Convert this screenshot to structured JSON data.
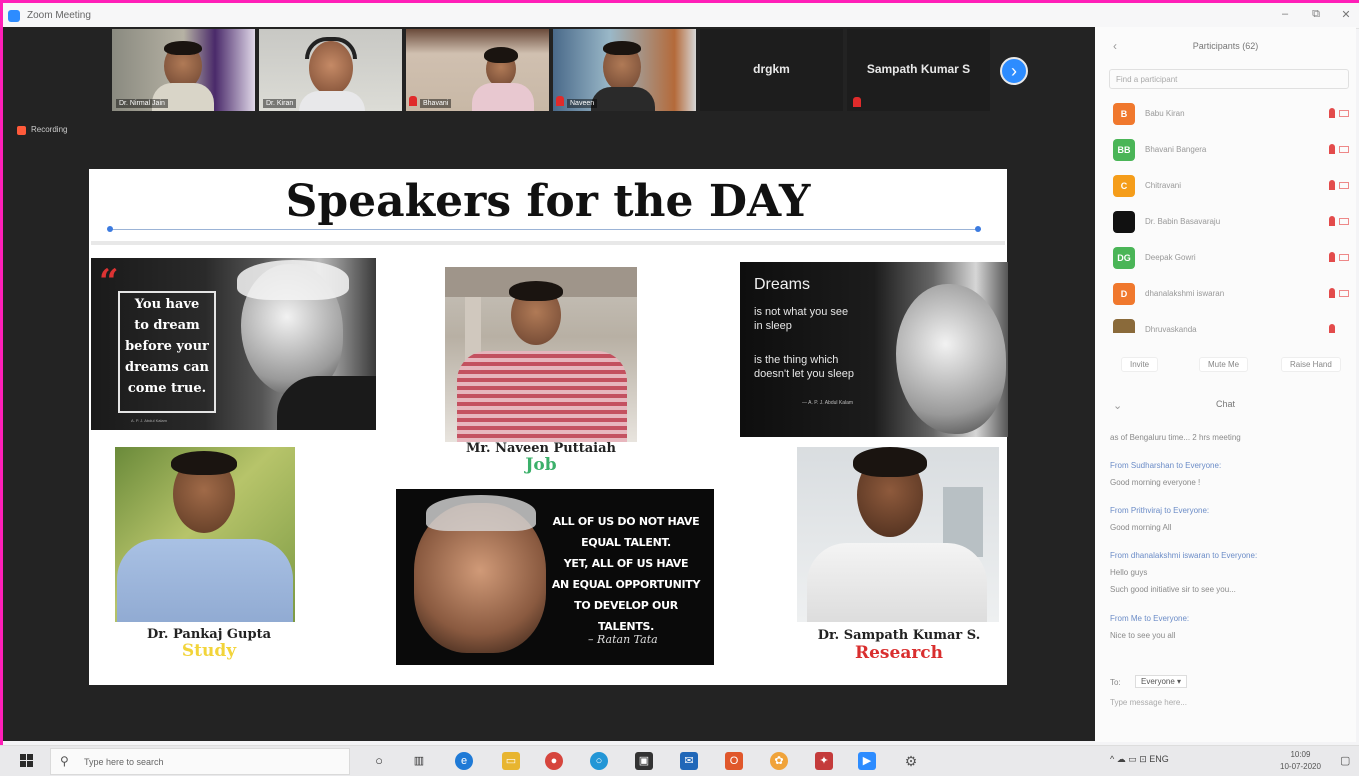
{
  "window": {
    "title": "Zoom Meeting",
    "controls": [
      "–",
      "⧉",
      "✕"
    ]
  },
  "video_strip": {
    "tiles": [
      {
        "name": "Dr. Nirmal Jain",
        "muted": false
      },
      {
        "name": "Dr. Kiran",
        "muted": false
      },
      {
        "name": "Bhavani",
        "muted": true
      },
      {
        "name": "Naveen",
        "muted": true
      }
    ],
    "name_tiles": [
      {
        "name": "drgkm",
        "muted": true
      },
      {
        "name": "Sampath Kumar S",
        "muted": true
      }
    ],
    "next_icon": "chevron-right-icon"
  },
  "recording": {
    "label": "Recording"
  },
  "slide": {
    "title": "Speakers for the DAY",
    "quote1": {
      "mark": "“",
      "lines": [
        "You have",
        "to dream",
        "before your",
        "dreams can",
        "come true."
      ],
      "attribution": "A. P. J. Abdul Kalam"
    },
    "quote2": {
      "heading": "Dreams",
      "lines": [
        "is not what you see",
        "in sleep",
        "",
        "is the thing which",
        "doesn't let you sleep"
      ],
      "attribution": "— A. P. J. Abdul Kalam"
    },
    "quote3": {
      "lines": [
        "ALL OF US DO NOT HAVE",
        "EQUAL TALENT.",
        "YET, ALL OF US HAVE",
        "AN EQUAL OPPORTUNITY",
        "TO DEVELOP OUR TALENTS."
      ],
      "signature": "– Ratan Tata"
    },
    "speakers": [
      {
        "name": "Mr. Naveen Puttaiah",
        "topic": "Job",
        "topic_color": "#3bb06a"
      },
      {
        "name": "Dr. Pankaj Gupta",
        "topic": "Study",
        "topic_color": "#f2d43a"
      },
      {
        "name": "Dr. Sampath Kumar S.",
        "topic": "Research",
        "topic_color": "#d92e2e"
      }
    ]
  },
  "participants_panel": {
    "title": "Participants (62)",
    "search_placeholder": "Find a participant",
    "participants": [
      {
        "initial": "B",
        "name": "Babu Kiran",
        "color": "#f0782d"
      },
      {
        "initial": "BB",
        "name": "Bhavani Bangera",
        "color": "#4ab557"
      },
      {
        "initial": "C",
        "name": "Chitravani",
        "color": "#f59d1a"
      },
      {
        "initial": "",
        "name": "Dr. Babin Basavaraju",
        "color": "#111111"
      },
      {
        "initial": "DG",
        "name": "Deepak Gowri",
        "color": "#4ab557"
      },
      {
        "initial": "D",
        "name": "dhanalakshmi iswaran",
        "color": "#f0782d"
      },
      {
        "initial": "",
        "name": "Dhruvaskanda",
        "color": "#8a6a3a"
      }
    ],
    "actions": [
      "Invite",
      "Mute Me",
      "Raise Hand"
    ]
  },
  "chat": {
    "title": "Chat",
    "messages": [
      {
        "from": "",
        "text": "as of Bengaluru time... 2 hrs meeting"
      },
      {
        "from": "From Sudharshan to Everyone:",
        "text": "Good morning everyone !"
      },
      {
        "from": "From Prithviraj to Everyone:",
        "text": "Good morning All"
      },
      {
        "from": "From dhanalakshmi iswaran to Everyone:",
        "text": "Hello guys"
      },
      {
        "from": "",
        "text": "Such good initiative sir to see you..."
      },
      {
        "from": "From Me to Everyone:",
        "text": "Nice to see you all"
      }
    ],
    "to_label": "To:",
    "to_value": "Everyone ▾",
    "input_placeholder": "Type message here..."
  },
  "taskbar": {
    "search_placeholder": "Type here to search",
    "apps": [
      {
        "icon": "cortana-icon",
        "color": "#444444"
      },
      {
        "icon": "task-view-icon",
        "color": "#444444"
      },
      {
        "icon": "edge-icon",
        "color": "#1f7ad6"
      },
      {
        "icon": "file-explorer-icon",
        "color": "#e8b530"
      },
      {
        "icon": "chrome-icon",
        "color": "#d6453d"
      },
      {
        "icon": "app-circle-icon",
        "color": "#2396d6"
      },
      {
        "icon": "store-icon",
        "color": "#333333"
      },
      {
        "icon": "mail-icon",
        "color": "#2067b8"
      },
      {
        "icon": "office-icon",
        "color": "#e0572b"
      },
      {
        "icon": "photos-icon",
        "color": "#f0a33a"
      },
      {
        "icon": "paint-icon",
        "color": "#c43b3b"
      },
      {
        "icon": "zoom-icon",
        "color": "#2d8cff"
      },
      {
        "icon": "settings-icon",
        "color": "#555555"
      }
    ],
    "tray_text": "^  ☁  ▭  ⊡  ENG",
    "clock_time": "10:09",
    "clock_date": "10-07-2020"
  }
}
